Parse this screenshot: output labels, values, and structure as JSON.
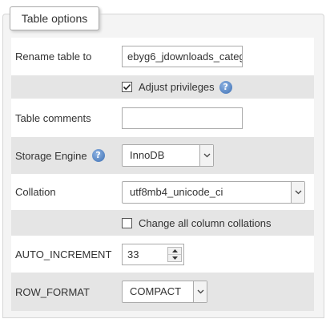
{
  "legend": "Table options",
  "rename": {
    "label": "Rename table to",
    "value": "ebyg6_jdownloads_categ"
  },
  "adjust_privileges": {
    "label": "Adjust privileges",
    "checked": true
  },
  "comments": {
    "label": "Table comments",
    "value": ""
  },
  "storage_engine": {
    "label": "Storage Engine",
    "selected": "InnoDB"
  },
  "collation": {
    "label": "Collation",
    "selected": "utf8mb4_unicode_ci"
  },
  "change_collations": {
    "label": "Change all column collations",
    "checked": false
  },
  "auto_increment": {
    "label": "AUTO_INCREMENT",
    "value": "33"
  },
  "row_format": {
    "label": "ROW_FORMAT",
    "selected": "COMPACT"
  },
  "icons": {
    "help": "help-icon",
    "dropdown": "chevron-down-icon",
    "check": "checkmark-icon",
    "spin_up": "spin-up-icon",
    "spin_down": "spin-down-icon"
  },
  "colors": {
    "help_blue": "#3d6fb3",
    "row_gray": "#e5e5e5",
    "panel_bg": "#f4f4f4"
  }
}
